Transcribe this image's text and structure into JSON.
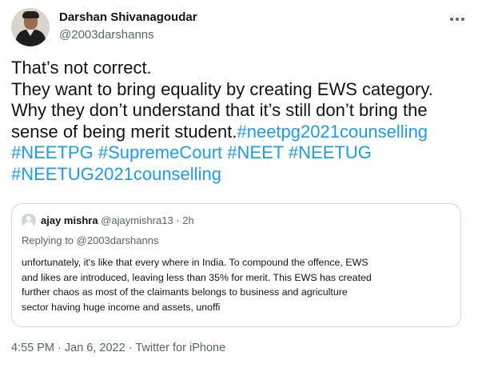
{
  "author": {
    "display_name": "Darshan Shivanagoudar",
    "handle": "@2003darshanns"
  },
  "tweet": {
    "lines": [
      [
        {
          "text": "That’s not correct.",
          "hashtag": false
        }
      ],
      [
        {
          "text": "They want to bring equality by creating EWS category.",
          "hashtag": false
        }
      ],
      [
        {
          "text": "Why they don’t understand that it’s still don’t bring the",
          "hashtag": false
        }
      ],
      [
        {
          "text": "sense of being merit student.",
          "hashtag": false
        },
        {
          "text": "#neetpg2021counselling",
          "hashtag": true
        }
      ],
      [
        {
          "text": "#NEETPG",
          "hashtag": true
        },
        {
          "text": " ",
          "hashtag": false
        },
        {
          "text": "#SupremeCourt",
          "hashtag": true
        },
        {
          "text": " ",
          "hashtag": false
        },
        {
          "text": "#NEET",
          "hashtag": true
        },
        {
          "text": " ",
          "hashtag": false
        },
        {
          "text": "#NEETUG",
          "hashtag": true
        }
      ],
      [
        {
          "text": "#NEETUG2021counselling",
          "hashtag": true
        }
      ]
    ]
  },
  "quoted_tweet": {
    "display_name": "ajay mishra",
    "handle": "@ajaymishra13",
    "time": "2h",
    "separator": " · ",
    "replying_prefix": "Replying to ",
    "replying_handle": "@2003darshanns",
    "body_lines": [
      "unfortunately, it's like that every where in India. To compound the offence, EWS",
      "and likes are introduced, leaving less than 35% for merit. This EWS has created",
      "further chaos as most of the claimants belongs to business and agriculture",
      "sector having huge income and assets, unoffi"
    ]
  },
  "meta": {
    "time": "4:55 PM",
    "date": "Jan 6, 2022",
    "separator": " · ",
    "source": "Twitter for iPhone"
  },
  "colors": {
    "text": "#0f1419",
    "secondary": "#536471",
    "link": "#1d9bf0",
    "border": "#cfd9de"
  },
  "icons": {
    "more": "more-horizontal-icon",
    "author_avatar": "avatar",
    "quote_avatar": "default-avatar-icon"
  }
}
